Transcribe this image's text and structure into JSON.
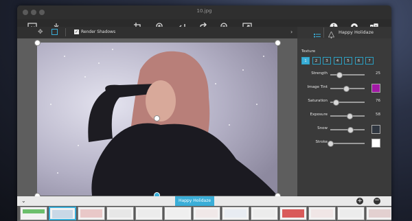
{
  "window": {
    "title": "10.jpg"
  },
  "toolbar": {
    "left_icons": [
      "picture-icon",
      "tray-icon"
    ],
    "center_icons": [
      "crop-icon",
      "zoom-in-icon",
      "undo-icon",
      "redo-icon",
      "zoom-out-icon",
      "fit-icon"
    ],
    "right_icons": [
      "info-icon",
      "settings-icon",
      "dice-icon"
    ]
  },
  "options": {
    "render_shadows_label": "Render Shadows",
    "render_shadows_checked": true
  },
  "panel": {
    "header_title": "Happy Holidaze",
    "texture_label": "Texture",
    "texture_options": [
      "1",
      "2",
      "3",
      "4",
      "5",
      "6",
      "7"
    ],
    "texture_selected": "1",
    "controls": [
      {
        "label": "Strength",
        "value": "25",
        "level": 0.25
      },
      {
        "label": "Image Tint",
        "value": "",
        "level": 0.45,
        "swatch": "#a319a6"
      },
      {
        "label": "Saturation",
        "value": "76",
        "level": 0.15
      },
      {
        "label": "Exposure",
        "value": "58",
        "level": 0.55
      },
      {
        "label": "Snow",
        "value": "",
        "level": 0.58,
        "swatch": "#2f3640"
      },
      {
        "label": "Stroke",
        "value": "",
        "level": 0.0,
        "swatch": "#ffffff"
      }
    ]
  },
  "bottom": {
    "selected_label": "Happy Holidaze"
  },
  "colors": {
    "accent": "#3aaed8",
    "panel_bg": "#3a3a3a",
    "toolbar_bg": "#2b2b2b"
  }
}
